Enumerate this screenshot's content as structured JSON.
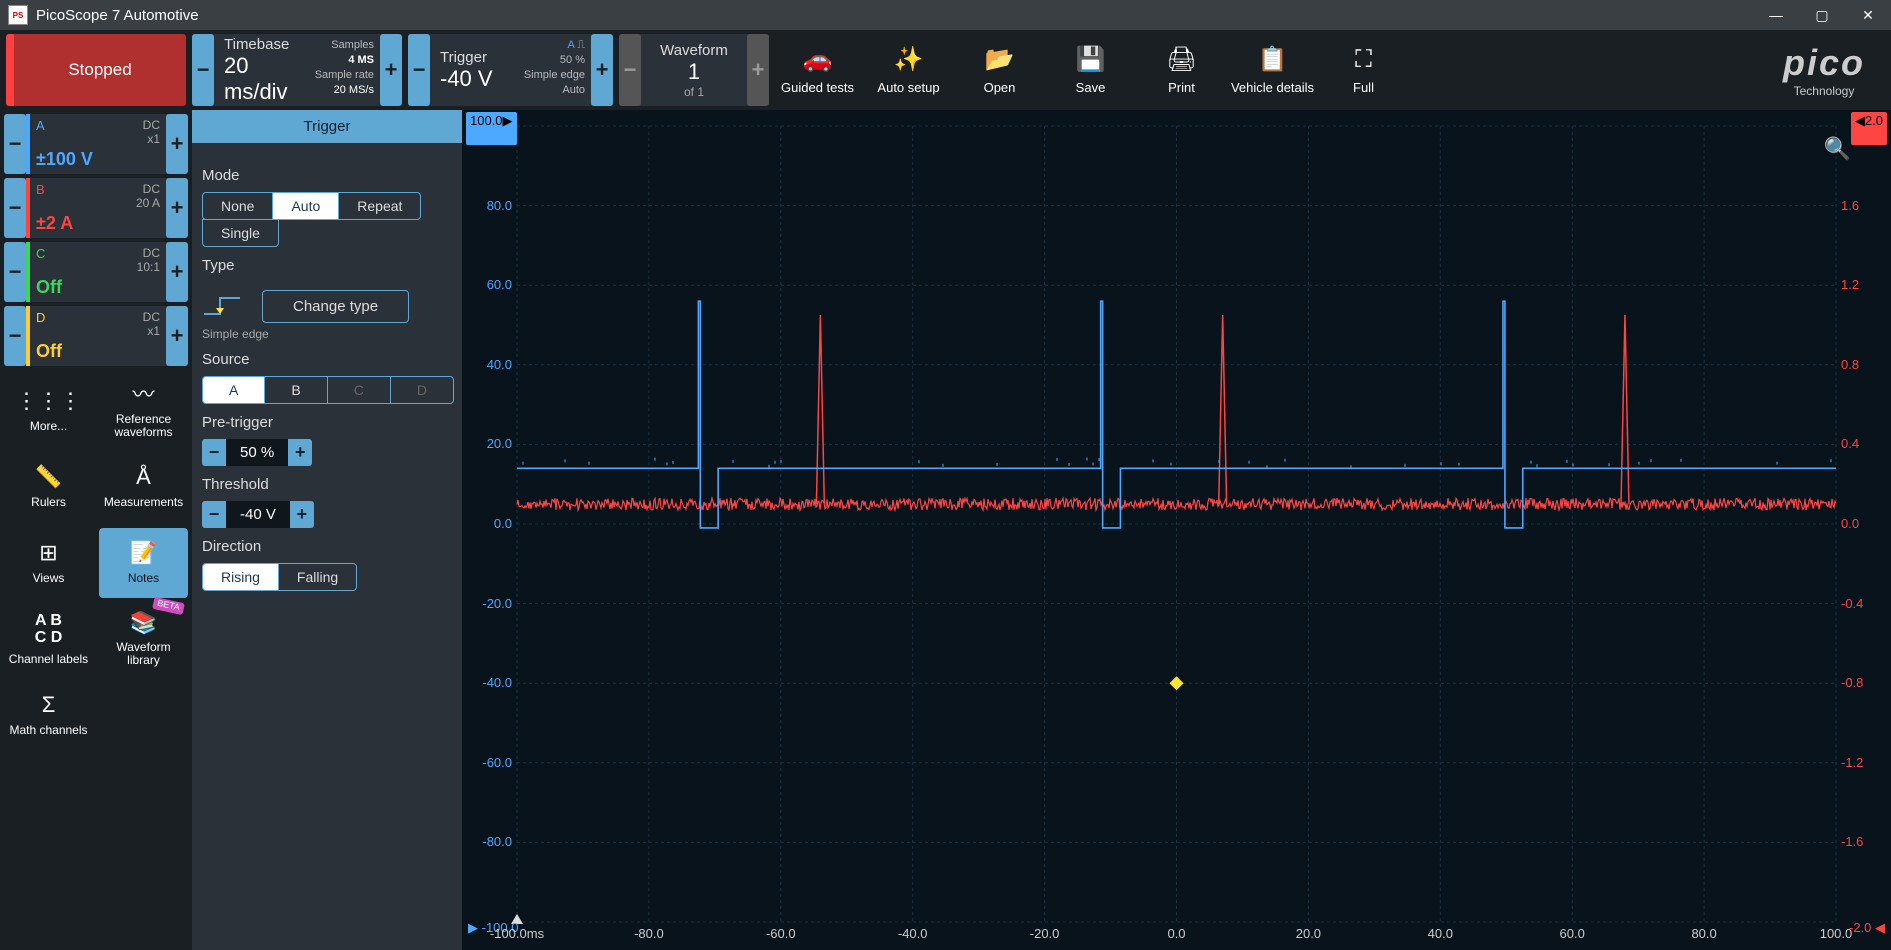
{
  "window": {
    "title": "PicoScope 7 Automotive"
  },
  "status": {
    "label": "Stopped"
  },
  "timebase": {
    "title": "Timebase",
    "value": "20 ms/div",
    "samples_lbl": "Samples",
    "samples": "4 MS",
    "rate_lbl": "Sample rate",
    "rate": "20 MS/s"
  },
  "trigger_top": {
    "title": "Trigger",
    "value": "-40 V",
    "pct": "50 %",
    "edge": "Simple edge",
    "mode": "Auto",
    "ch": "A"
  },
  "waveform": {
    "title": "Waveform",
    "num": "1",
    "of": "of 1"
  },
  "tools": {
    "guided": "Guided tests",
    "auto": "Auto setup",
    "open": "Open",
    "save": "Save",
    "print": "Print",
    "vehicle": "Vehicle details",
    "full": "Full"
  },
  "brand": {
    "name": "pico",
    "sub": "Technology"
  },
  "ch": {
    "A": {
      "name": "A",
      "coupling": "DC",
      "probe": "x1",
      "range": "±100 V"
    },
    "B": {
      "name": "B",
      "coupling": "DC",
      "probe": "20 A",
      "range": "±2 A"
    },
    "C": {
      "name": "C",
      "coupling": "DC",
      "probe": "10:1",
      "range": "Off"
    },
    "D": {
      "name": "D",
      "coupling": "DC",
      "probe": "x1",
      "range": "Off"
    }
  },
  "side": {
    "more": "More...",
    "ref": "Reference waveforms",
    "rulers": "Rulers",
    "meas": "Measurements",
    "views": "Views",
    "notes": "Notes",
    "chlbl": "Channel labels",
    "wlib": "Waveform library",
    "math": "Math channels",
    "beta": "BETA"
  },
  "panel": {
    "title": "Trigger",
    "mode_lbl": "Mode",
    "mode": {
      "none": "None",
      "auto": "Auto",
      "repeat": "Repeat",
      "single": "Single"
    },
    "type_lbl": "Type",
    "type_name": "Simple edge",
    "change": "Change type",
    "source_lbl": "Source",
    "sources": {
      "A": "A",
      "B": "B",
      "C": "C",
      "D": "D"
    },
    "pretrig_lbl": "Pre-trigger",
    "pretrig": "50 %",
    "thresh_lbl": "Threshold",
    "thresh": "-40 V",
    "dir_lbl": "Direction",
    "dir": {
      "rising": "Rising",
      "falling": "Falling"
    }
  },
  "axes": {
    "left_top": "100.0",
    "left_unit": "V",
    "right_top": "2.0",
    "right_unit": "A",
    "y_left": [
      "80.0",
      "60.0",
      "40.0",
      "20.0",
      "0.0",
      "-20.0",
      "-40.0",
      "-60.0",
      "-80.0"
    ],
    "y_right": [
      "1.6",
      "1.2",
      "0.8",
      "0.4",
      "0.0",
      "-0.4",
      "-0.8",
      "-1.2",
      "-1.6"
    ],
    "left_bot": "-100.0",
    "right_bot": "-2.0",
    "x": [
      "-100.0ms",
      "-80.0",
      "-60.0",
      "-40.0",
      "-20.0",
      "0.0",
      "20.0",
      "40.0",
      "60.0",
      "80.0",
      "100.0"
    ]
  },
  "chart_data": {
    "type": "line",
    "x_range_ms": [
      -100,
      100
    ],
    "channels": {
      "A": {
        "unit": "V",
        "ylim": [
          -100,
          100
        ],
        "baseline": 14,
        "floor": -1,
        "pulses_ms": [
          -72.5,
          -11.5,
          49.5
        ],
        "pulse_width_ms": 3,
        "pulse_top": 56,
        "noise_amp": 0.8
      },
      "B": {
        "unit": "A",
        "ylim": [
          -2,
          2
        ],
        "baseline": 0.1,
        "spikes_ms": [
          -54,
          7,
          68
        ],
        "spike_peak": 1.05,
        "spike_width_ms": 1.2,
        "noise_amp": 0.03
      }
    },
    "trigger": {
      "time_ms": 0,
      "level_V": -40
    }
  }
}
